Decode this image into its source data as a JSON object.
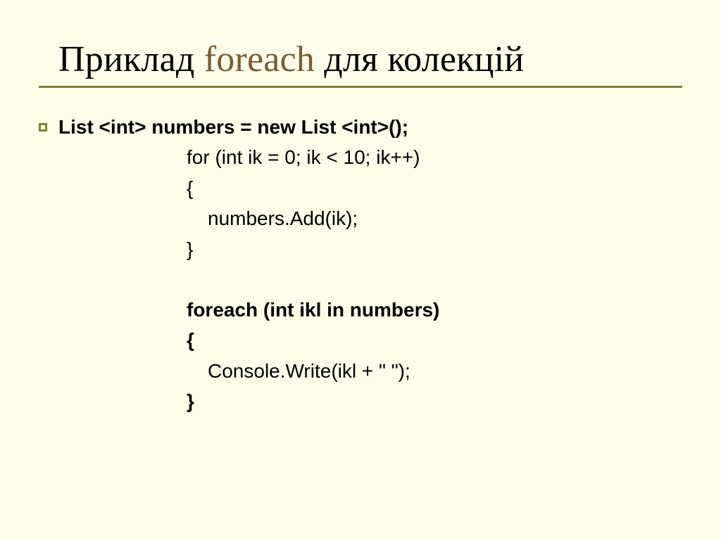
{
  "title": {
    "prefix": "Приклад ",
    "accent": "foreach",
    "suffix": " для колекцій"
  },
  "code": {
    "l0": "List <int> numbers = new List <int>();",
    "l1": "for (int ik = 0; ik < 10; ik++)",
    "l2": "{",
    "l3": "numbers.Add(ik);",
    "l4": "}",
    "l5": "foreach (int ikl in numbers)",
    "l6": "{",
    "l7": "Console.Write(ikl + \" \");",
    "l8": "}"
  }
}
